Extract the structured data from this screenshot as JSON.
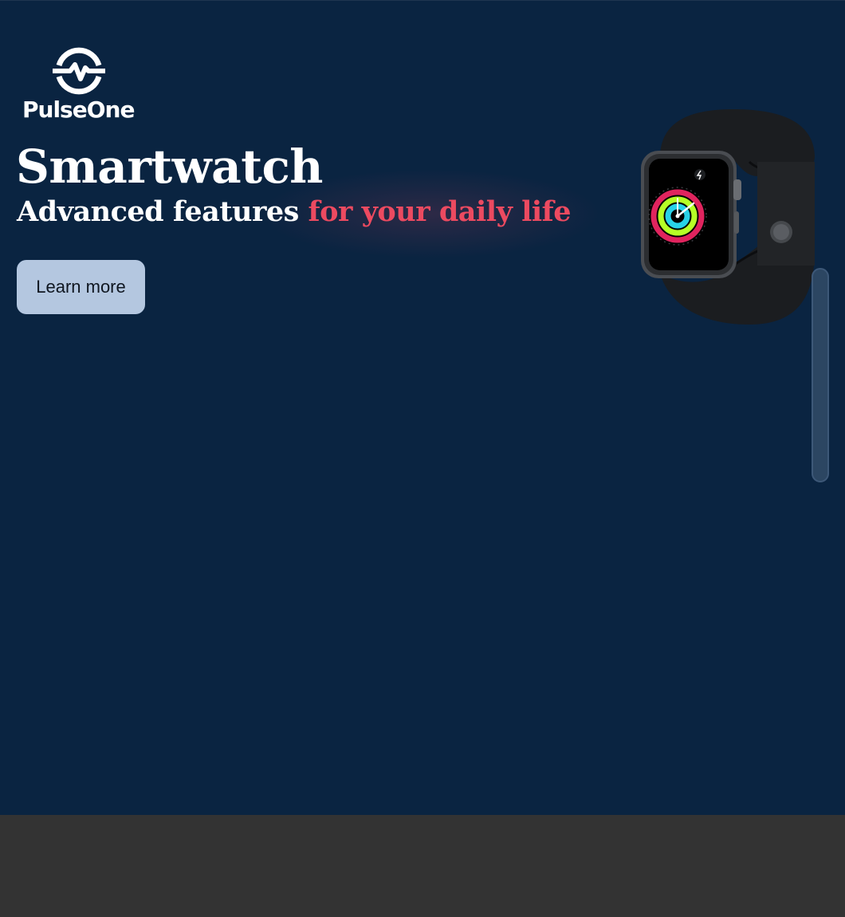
{
  "brand": {
    "name": "PulseOne",
    "logo_icon": "pulse-heartbeat-icon"
  },
  "hero": {
    "title": "Smartwatch",
    "subtitle_lead": "Advanced features ",
    "subtitle_accent": "for your daily life",
    "cta_label": "Learn more",
    "product_image": "smartwatch-image"
  },
  "colors": {
    "hero_background": "#0a2441",
    "footer_background": "#333333",
    "accent": "#ec4a60",
    "button_background": "#b4c7e0"
  }
}
